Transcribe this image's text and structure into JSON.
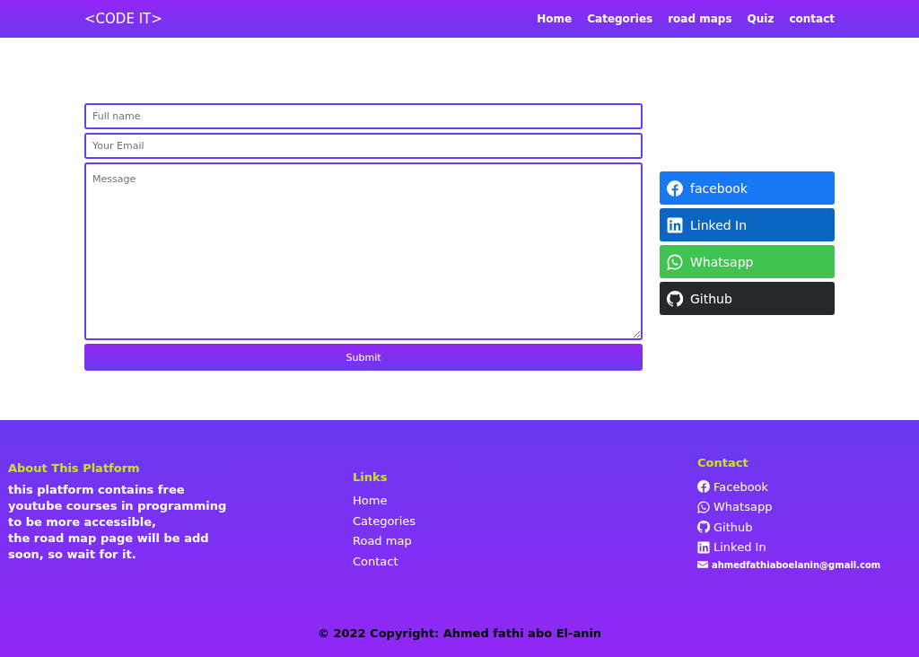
{
  "navbar": {
    "brand": "<CODE IT>",
    "links": [
      "Home",
      "Categories",
      "road maps",
      "Quiz",
      "contact"
    ]
  },
  "form": {
    "fields": [
      {
        "kind": "input",
        "placeholder": "Full name"
      },
      {
        "kind": "input",
        "placeholder": "Your Email"
      },
      {
        "kind": "textarea",
        "placeholder": "Message"
      }
    ],
    "submit": "Submit"
  },
  "social_buttons": [
    {
      "kind": "facebook",
      "label": "facebook",
      "color": "#1877f2"
    },
    {
      "kind": "linkedin",
      "label": "Linked In",
      "color": "#0a66c2"
    },
    {
      "kind": "whatsapp",
      "label": "Whatsapp",
      "color": "#40c351"
    },
    {
      "kind": "github",
      "label": "Github",
      "color": "#24292e"
    }
  ],
  "footer": {
    "about": {
      "heading": "About This Platform",
      "lines": [
        "this platform contains free",
        "youtube courses in programming",
        "to be more accessible,",
        "the road map page will be add",
        "soon, so wait for it."
      ]
    },
    "links": {
      "heading": "Links",
      "items": [
        "Home",
        "Categories",
        "Road map",
        "Contact"
      ]
    },
    "contact": {
      "heading": "Contact",
      "items": [
        {
          "kind": "facebook",
          "label": "Facebook"
        },
        {
          "kind": "whatsapp",
          "label": "Whatsapp"
        },
        {
          "kind": "github",
          "label": "Github"
        },
        {
          "kind": "linkedin",
          "label": "Linked In"
        },
        {
          "kind": "email",
          "label": "ahmedfathiaboelanin@gmail.com"
        }
      ]
    },
    "copyright": "© 2022 Copyright: Ahmed fathi abo El-anin"
  }
}
